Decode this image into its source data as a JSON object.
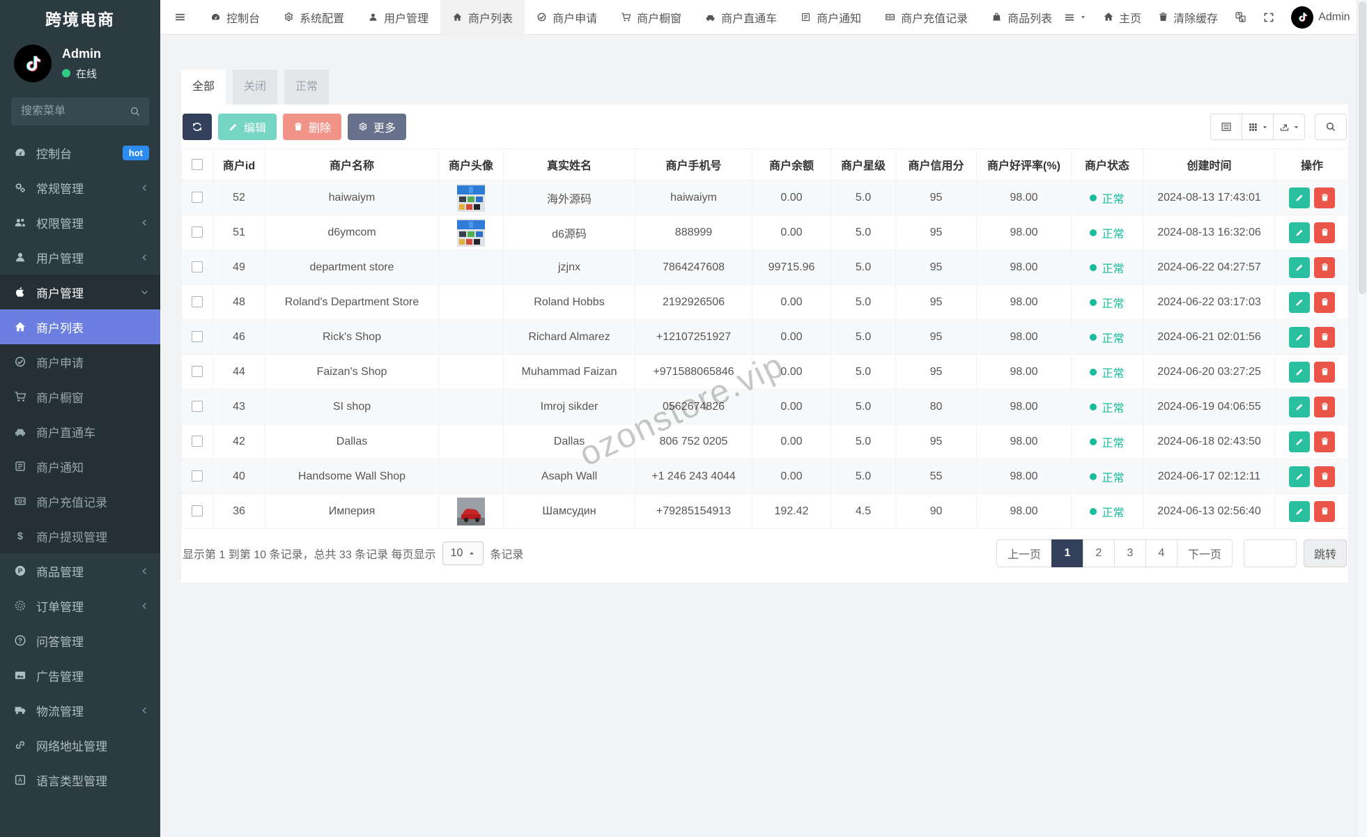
{
  "brand": {
    "title": "跨境电商"
  },
  "user_panel": {
    "name": "Admin",
    "status": "在线"
  },
  "sidebar": {
    "search_placeholder": "搜索菜单",
    "items": [
      {
        "key": "dashboard",
        "label": "控制台",
        "icon": "dashboard-icon",
        "badge": "hot"
      },
      {
        "key": "general",
        "label": "常规管理",
        "icon": "gears-icon",
        "chevron": "left"
      },
      {
        "key": "auth",
        "label": "权限管理",
        "icon": "users-icon",
        "chevron": "left"
      },
      {
        "key": "user",
        "label": "用户管理",
        "icon": "user-icon",
        "chevron": "left"
      },
      {
        "key": "merchant",
        "label": "商户管理",
        "icon": "apple-icon",
        "chevron": "down",
        "section": true
      },
      {
        "key": "merchant-list",
        "label": "商户列表",
        "icon": "home-icon",
        "sub": true,
        "active": true
      },
      {
        "key": "merchant-apply",
        "label": "商户申请",
        "icon": "check-circle-icon",
        "sub": true
      },
      {
        "key": "merchant-window",
        "label": "商户橱窗",
        "icon": "cart-icon",
        "sub": true
      },
      {
        "key": "merchant-train",
        "label": "商户直通车",
        "icon": "car-icon",
        "sub": true
      },
      {
        "key": "merchant-notice",
        "label": "商户通知",
        "icon": "notice-icon",
        "sub": true
      },
      {
        "key": "merchant-recharge",
        "label": "商户充值记录",
        "icon": "money-icon",
        "sub": true
      },
      {
        "key": "merchant-withdraw",
        "label": "商户提现管理",
        "icon": "dollar-icon",
        "sub": true
      },
      {
        "key": "product",
        "label": "商品管理",
        "icon": "product-icon",
        "chevron": "left"
      },
      {
        "key": "order",
        "label": "订单管理",
        "icon": "order-icon",
        "chevron": "left"
      },
      {
        "key": "qa",
        "label": "问答管理",
        "icon": "question-icon"
      },
      {
        "key": "ad",
        "label": "广告管理",
        "icon": "ad-icon"
      },
      {
        "key": "logistics",
        "label": "物流管理",
        "icon": "truck-icon",
        "chevron": "left"
      },
      {
        "key": "url",
        "label": "网络地址管理",
        "icon": "link-icon"
      },
      {
        "key": "language",
        "label": "语言类型管理",
        "icon": "language-icon"
      }
    ]
  },
  "topnav": {
    "tabs": [
      {
        "key": "dashboard",
        "label": "控制台",
        "icon": "dashboard-icon"
      },
      {
        "key": "config",
        "label": "系统配置",
        "icon": "gear-icon"
      },
      {
        "key": "user",
        "label": "用户管理",
        "icon": "user-icon"
      },
      {
        "key": "merchant-list",
        "label": "商户列表",
        "icon": "home-icon",
        "active": true
      },
      {
        "key": "merchant-apply",
        "label": "商户申请",
        "icon": "check-circle-icon"
      },
      {
        "key": "merchant-window",
        "label": "商户橱窗",
        "icon": "cart-icon"
      },
      {
        "key": "merchant-train",
        "label": "商户直通车",
        "icon": "car-icon"
      },
      {
        "key": "merchant-notice",
        "label": "商户通知",
        "icon": "notice-icon"
      },
      {
        "key": "merchant-recharge",
        "label": "商户充值记录",
        "icon": "money-icon"
      },
      {
        "key": "product-list",
        "label": "商品列表",
        "icon": "bag-icon"
      }
    ],
    "right": {
      "home_label": "主页",
      "clear_cache_label": "清除缓存",
      "username": "Admin"
    }
  },
  "filter_tabs": {
    "labels": [
      "全部",
      "关闭",
      "正常"
    ],
    "active_index": 0
  },
  "toolbar": {
    "edit_label": "编辑",
    "delete_label": "删除",
    "more_label": "更多"
  },
  "table": {
    "columns": [
      "商户id",
      "商户名称",
      "商户头像",
      "真实姓名",
      "商户手机号",
      "商户余额",
      "商户星级",
      "商户信用分",
      "商户好评率(%)",
      "商户状态",
      "创建时间",
      "操作"
    ],
    "rows": [
      {
        "id": "52",
        "name": "haiwaiym",
        "avatar": "site",
        "real_name": "海外源码",
        "phone": "haiwaiym",
        "balance": "0.00",
        "stars": "5.0",
        "credit": "95",
        "rating": "98.00",
        "status": "正常",
        "created": "2024-08-13 17:43:01"
      },
      {
        "id": "51",
        "name": "d6ymcom",
        "avatar": "site",
        "real_name": "d6源码",
        "phone": "888999",
        "balance": "0.00",
        "stars": "5.0",
        "credit": "95",
        "rating": "98.00",
        "status": "正常",
        "created": "2024-08-13 16:32:06"
      },
      {
        "id": "49",
        "name": "department store",
        "avatar": "",
        "real_name": "jzjnx",
        "phone": "7864247608",
        "balance": "99715.96",
        "stars": "5.0",
        "credit": "95",
        "rating": "98.00",
        "status": "正常",
        "created": "2024-06-22 04:27:57"
      },
      {
        "id": "48",
        "name": "Roland's Department Store",
        "avatar": "",
        "real_name": "Roland Hobbs",
        "phone": "2192926506",
        "balance": "0.00",
        "stars": "5.0",
        "credit": "95",
        "rating": "98.00",
        "status": "正常",
        "created": "2024-06-22 03:17:03"
      },
      {
        "id": "46",
        "name": "Rick's Shop",
        "avatar": "",
        "real_name": "Richard Almarez",
        "phone": "+12107251927",
        "balance": "0.00",
        "stars": "5.0",
        "credit": "95",
        "rating": "98.00",
        "status": "正常",
        "created": "2024-06-21 02:01:56"
      },
      {
        "id": "44",
        "name": "Faizan's Shop",
        "avatar": "",
        "real_name": "Muhammad Faizan",
        "phone": "+971588065846",
        "balance": "0.00",
        "stars": "5.0",
        "credit": "95",
        "rating": "98.00",
        "status": "正常",
        "created": "2024-06-20 03:27:25"
      },
      {
        "id": "43",
        "name": "SI shop",
        "avatar": "",
        "real_name": "Imroj sikder",
        "phone": "0562674826",
        "balance": "0.00",
        "stars": "5.0",
        "credit": "80",
        "rating": "98.00",
        "status": "正常",
        "created": "2024-06-19 04:06:55"
      },
      {
        "id": "42",
        "name": "Dallas",
        "avatar": "",
        "real_name": "Dallas",
        "phone": "806 752 0205",
        "balance": "0.00",
        "stars": "5.0",
        "credit": "95",
        "rating": "98.00",
        "status": "正常",
        "created": "2024-06-18 02:43:50"
      },
      {
        "id": "40",
        "name": "Handsome Wall Shop",
        "avatar": "",
        "real_name": "Asaph Wall",
        "phone": "+1 246 243 4044",
        "balance": "0.00",
        "stars": "5.0",
        "credit": "55",
        "rating": "98.00",
        "status": "正常",
        "created": "2024-06-17 02:12:11"
      },
      {
        "id": "36",
        "name": "Империя",
        "avatar": "car",
        "real_name": "Шамсудин",
        "phone": "+79285154913",
        "balance": "192.42",
        "stars": "4.5",
        "credit": "90",
        "rating": "98.00",
        "status": "正常",
        "created": "2024-06-13 02:56:40"
      }
    ]
  },
  "pagination": {
    "summary_before": "显示第 1 到第 10 条记录，总共 33 条记录 每页显示",
    "page_size": "10",
    "summary_after": "条记录",
    "prev_label": "上一页",
    "next_label": "下一页",
    "pages": [
      "1",
      "2",
      "3",
      "4"
    ],
    "active_page": "1",
    "jump_label": "跳转"
  },
  "watermark": "ozonstore.vip",
  "colors": {
    "sidebar_bg": "#2c3b41",
    "sidebar_section_bg": "#242f36",
    "active_menu": "#6c7fe0",
    "hot_badge": "#2d8cf0",
    "primary_dark": "#34405b",
    "success": "#18bc9c",
    "danger": "#e74c3c",
    "more_btn": "#67718c",
    "status_normal": "#18bc9c"
  }
}
